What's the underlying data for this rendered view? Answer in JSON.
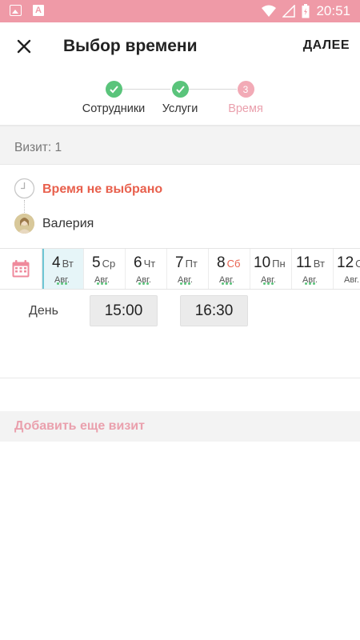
{
  "status_bar": {
    "time": "20:51",
    "icons": [
      "image-icon",
      "a-icon",
      "wifi-icon",
      "signal-icon",
      "battery-icon"
    ]
  },
  "app_bar": {
    "title": "Выбор времени",
    "next_label": "ДАЛЕЕ",
    "close_icon": "close-icon"
  },
  "stepper": {
    "steps": [
      {
        "label": "Сотрудники",
        "state": "done"
      },
      {
        "label": "Услуги",
        "state": "done"
      },
      {
        "label": "Время",
        "state": "current",
        "number": "3"
      }
    ]
  },
  "visit": {
    "header": "Визит: 1",
    "time_status": "Время не выбрано",
    "employee": "Валерия"
  },
  "calendar": {
    "days": [
      {
        "num": "4",
        "weekday": "Вт",
        "month": "Авг.",
        "selected": true
      },
      {
        "num": "5",
        "weekday": "Ср",
        "month": "Авг."
      },
      {
        "num": "6",
        "weekday": "Чт",
        "month": "Авг."
      },
      {
        "num": "7",
        "weekday": "Пт",
        "month": "Авг."
      },
      {
        "num": "8",
        "weekday": "Сб",
        "month": "Авг.",
        "weekend": true
      },
      {
        "num": "10",
        "weekday": "Пн",
        "month": "Авг."
      },
      {
        "num": "11",
        "weekday": "Вт",
        "month": "Авг."
      },
      {
        "num": "12",
        "weekday": "Ср",
        "month": "Авг."
      }
    ]
  },
  "time_slots": {
    "period_label": "День",
    "slots": [
      "15:00",
      "16:30"
    ]
  },
  "add_visit_label": "Добавить еще визит",
  "colors": {
    "status_bar": "#ef9aa7",
    "done": "#5ac47b",
    "current": "#f2aab6",
    "accent_red": "#e8604d",
    "selected_day": "#e6f5f8"
  }
}
